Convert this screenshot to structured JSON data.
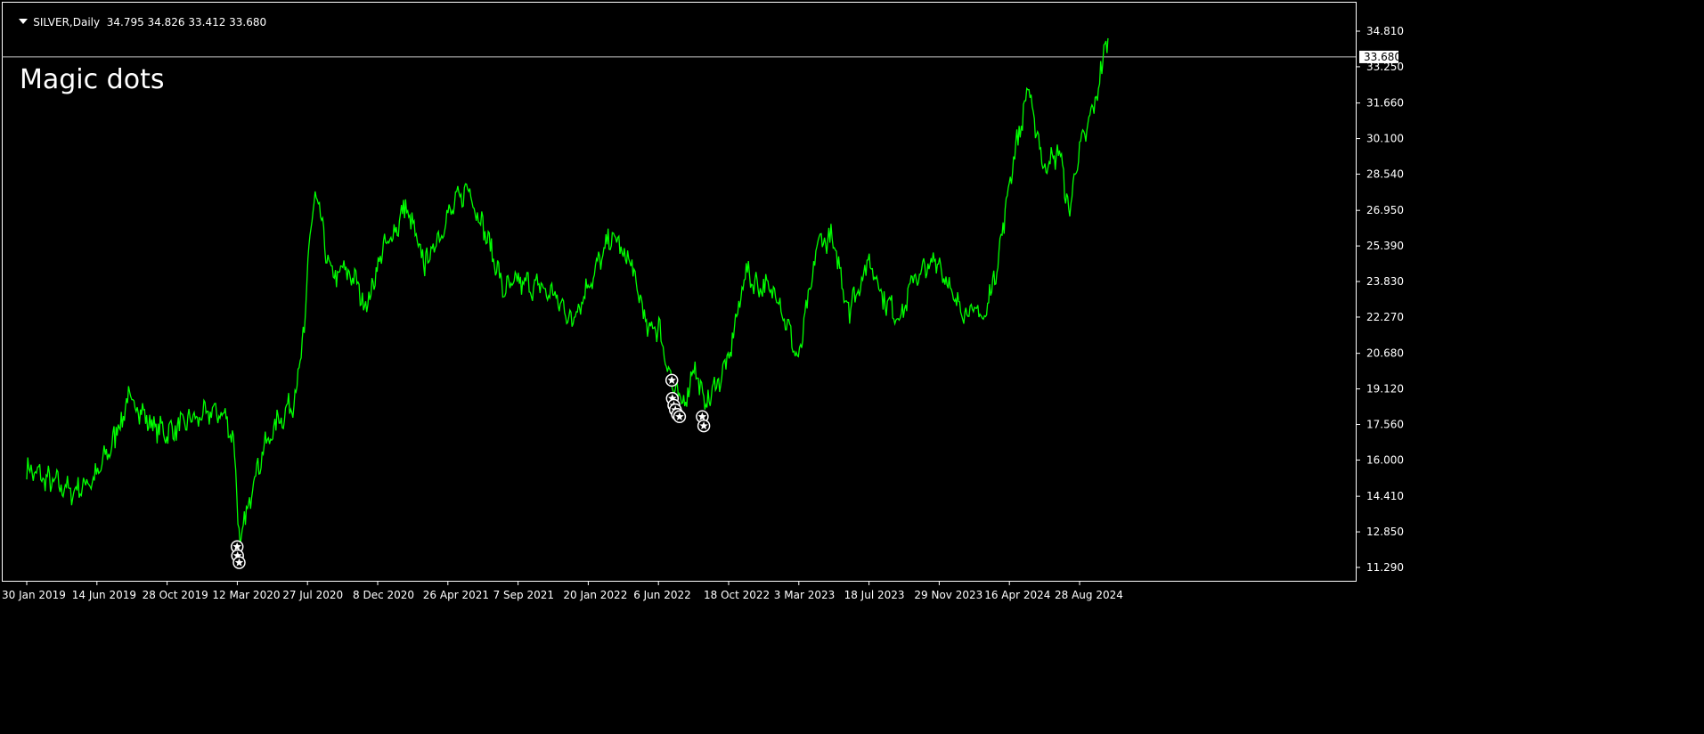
{
  "header": {
    "symbol": "SILVER,Daily",
    "ohlc": "34.795 34.826 33.412 33.680"
  },
  "indicator_title": "Magic dots",
  "colors": {
    "background": "#000000",
    "price_line": "#00FF00",
    "frame": "#ffffff",
    "marker": "#ffffff"
  },
  "chart_data": {
    "type": "line",
    "title": "",
    "xlabel": "",
    "ylabel": "",
    "x_ticks": [
      "30 Jan 2019",
      "14 Jun 2019",
      "28 Oct 2019",
      "12 Mar 2020",
      "27 Jul 2020",
      "8 Dec 2020",
      "26 Apr 2021",
      "7 Sep 2021",
      "20 Jan 2022",
      "6 Jun 2022",
      "18 Oct 2022",
      "3 Mar 2023",
      "18 Jul 2023",
      "29 Nov 2023",
      "16 Apr 2024",
      "28 Aug 2024"
    ],
    "y_ticks": [
      "34.810",
      "33.250",
      "31.660",
      "30.100",
      "28.540",
      "26.950",
      "25.390",
      "23.830",
      "22.270",
      "20.680",
      "19.120",
      "17.560",
      "16.000",
      "14.410",
      "12.850",
      "11.290"
    ],
    "ylim": [
      10.9,
      35.8
    ],
    "current_price": 33.68,
    "current_price_label": "33.680",
    "series": [
      {
        "x": [
          "2019-01-30",
          "2019-03-15",
          "2019-05-01",
          "2019-06-14",
          "2019-07-20",
          "2019-08-15",
          "2019-09-05",
          "2019-10-01",
          "2019-10-28",
          "2019-12-20",
          "2020-02-10",
          "2020-03-05",
          "2020-03-18",
          "2020-04-15",
          "2020-05-20",
          "2020-06-30",
          "2020-07-20",
          "2020-07-27",
          "2020-08-10",
          "2020-09-10",
          "2020-10-15",
          "2020-11-20",
          "2020-12-08",
          "2021-01-20",
          "2021-02-01",
          "2021-03-10",
          "2021-04-26",
          "2021-06-01",
          "2021-07-15",
          "2021-08-10",
          "2021-09-07",
          "2021-10-15",
          "2021-11-15",
          "2021-12-20",
          "2022-01-20",
          "2022-03-08",
          "2022-04-15",
          "2022-05-15",
          "2022-06-06",
          "2022-07-01",
          "2022-07-20",
          "2022-08-15",
          "2022-09-01",
          "2022-10-18",
          "2022-11-20",
          "2022-12-15",
          "2023-01-20",
          "2023-03-03",
          "2023-04-10",
          "2023-05-05",
          "2023-06-10",
          "2023-07-18",
          "2023-08-20",
          "2023-09-20",
          "2023-10-05",
          "2023-11-29",
          "2023-12-30",
          "2024-01-25",
          "2024-02-28",
          "2024-03-25",
          "2024-04-16",
          "2024-05-20",
          "2024-06-20",
          "2024-07-20",
          "2024-08-07",
          "2024-08-28",
          "2024-09-25",
          "2024-10-10",
          "2024-10-22"
        ],
        "y": [
          15.6,
          15.1,
          14.6,
          15.3,
          17.0,
          18.7,
          18.2,
          17.5,
          17.2,
          17.8,
          18.2,
          17.0,
          12.2,
          15.4,
          17.4,
          18.6,
          21.5,
          24.8,
          27.8,
          24.0,
          24.4,
          22.6,
          24.7,
          26.4,
          27.2,
          24.5,
          26.8,
          28.0,
          25.4,
          23.4,
          23.8,
          23.6,
          23.2,
          22.2,
          23.6,
          25.9,
          24.4,
          21.8,
          21.8,
          19.4,
          18.2,
          20.2,
          18.3,
          20.3,
          24.2,
          23.7,
          23.3,
          20.4,
          25.5,
          25.8,
          22.6,
          24.8,
          22.9,
          22.2,
          23.8,
          24.8,
          23.0,
          22.5,
          22.4,
          25.0,
          28.5,
          32.2,
          28.9,
          29.5,
          27.0,
          29.5,
          31.5,
          33.2,
          34.5
        ]
      }
    ],
    "markers": {
      "symbol": "star-in-circle",
      "points": [
        {
          "x": "2020-03-12",
          "y": 12.2
        },
        {
          "x": "2020-03-13",
          "y": 11.8
        },
        {
          "x": "2020-03-16",
          "y": 11.5
        },
        {
          "x": "2022-07-01",
          "y": 19.5
        },
        {
          "x": "2022-07-02",
          "y": 18.7
        },
        {
          "x": "2022-07-05",
          "y": 18.4
        },
        {
          "x": "2022-07-08",
          "y": 18.2
        },
        {
          "x": "2022-07-12",
          "y": 18.0
        },
        {
          "x": "2022-07-16",
          "y": 17.9
        },
        {
          "x": "2022-08-29",
          "y": 17.9
        },
        {
          "x": "2022-09-01",
          "y": 17.5
        }
      ]
    }
  }
}
